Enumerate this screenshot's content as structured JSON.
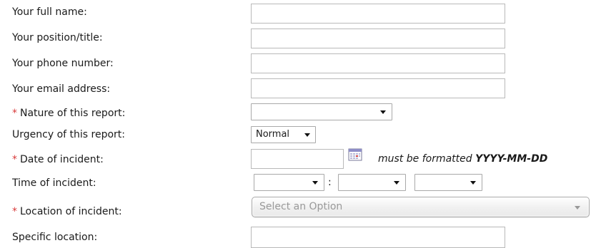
{
  "form": {
    "full_name": {
      "label": "Your full name:",
      "value": ""
    },
    "position": {
      "label": "Your position/title:",
      "value": ""
    },
    "phone": {
      "label": "Your phone number:",
      "value": ""
    },
    "email": {
      "label": "Your email address:",
      "value": ""
    },
    "nature": {
      "required_mark": "*",
      "label": "Nature of this report:",
      "selected": ""
    },
    "urgency": {
      "label": "Urgency of this report:",
      "selected": "Normal"
    },
    "date": {
      "required_mark": "*",
      "label": "Date of incident:",
      "value": "",
      "hint_prefix": "must be formatted",
      "hint_format": "YYYY-MM-DD"
    },
    "time": {
      "label": "Time of incident:",
      "hour": "",
      "separator": ":",
      "minute": "",
      "ampm": ""
    },
    "location": {
      "required_mark": "*",
      "label": "Location of incident:",
      "placeholder": "Select an Option"
    },
    "specific_location": {
      "label": "Specific location:",
      "value": ""
    }
  },
  "icons": {
    "calendar": "calendar-icon",
    "dropdown": "chevron-down-icon"
  }
}
